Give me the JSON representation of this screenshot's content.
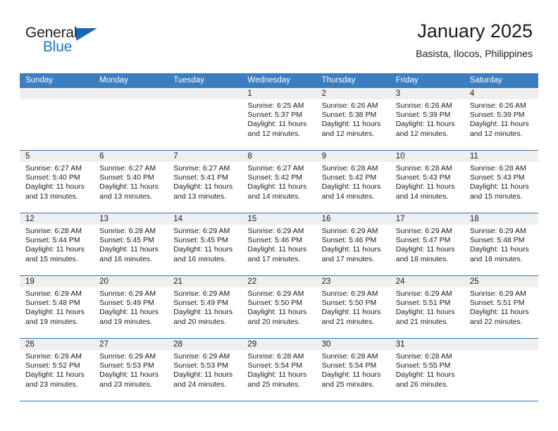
{
  "brand": {
    "name_part1": "General",
    "name_part2": "Blue"
  },
  "header": {
    "title": "January 2025",
    "subtitle": "Basista, Ilocos, Philippines"
  },
  "calendar": {
    "weekday_headers": [
      "Sunday",
      "Monday",
      "Tuesday",
      "Wednesday",
      "Thursday",
      "Friday",
      "Saturday"
    ],
    "accent_color": "#3a7ec0",
    "row_divider_color": "#2e75b6",
    "daynum_band_color": "#efefef",
    "weeks": [
      [
        {
          "day": "",
          "sunrise": "",
          "sunset": "",
          "daylight": "",
          "empty": true
        },
        {
          "day": "",
          "sunrise": "",
          "sunset": "",
          "daylight": "",
          "empty": true
        },
        {
          "day": "",
          "sunrise": "",
          "sunset": "",
          "daylight": "",
          "empty": true
        },
        {
          "day": "1",
          "sunrise": "Sunrise: 6:25 AM",
          "sunset": "Sunset: 5:37 PM",
          "daylight": "Daylight: 11 hours and 12 minutes."
        },
        {
          "day": "2",
          "sunrise": "Sunrise: 6:26 AM",
          "sunset": "Sunset: 5:38 PM",
          "daylight": "Daylight: 11 hours and 12 minutes."
        },
        {
          "day": "3",
          "sunrise": "Sunrise: 6:26 AM",
          "sunset": "Sunset: 5:39 PM",
          "daylight": "Daylight: 11 hours and 12 minutes."
        },
        {
          "day": "4",
          "sunrise": "Sunrise: 6:26 AM",
          "sunset": "Sunset: 5:39 PM",
          "daylight": "Daylight: 11 hours and 12 minutes."
        }
      ],
      [
        {
          "day": "5",
          "sunrise": "Sunrise: 6:27 AM",
          "sunset": "Sunset: 5:40 PM",
          "daylight": "Daylight: 11 hours and 13 minutes."
        },
        {
          "day": "6",
          "sunrise": "Sunrise: 6:27 AM",
          "sunset": "Sunset: 5:40 PM",
          "daylight": "Daylight: 11 hours and 13 minutes."
        },
        {
          "day": "7",
          "sunrise": "Sunrise: 6:27 AM",
          "sunset": "Sunset: 5:41 PM",
          "daylight": "Daylight: 11 hours and 13 minutes."
        },
        {
          "day": "8",
          "sunrise": "Sunrise: 6:27 AM",
          "sunset": "Sunset: 5:42 PM",
          "daylight": "Daylight: 11 hours and 14 minutes."
        },
        {
          "day": "9",
          "sunrise": "Sunrise: 6:28 AM",
          "sunset": "Sunset: 5:42 PM",
          "daylight": "Daylight: 11 hours and 14 minutes."
        },
        {
          "day": "10",
          "sunrise": "Sunrise: 6:28 AM",
          "sunset": "Sunset: 5:43 PM",
          "daylight": "Daylight: 11 hours and 14 minutes."
        },
        {
          "day": "11",
          "sunrise": "Sunrise: 6:28 AM",
          "sunset": "Sunset: 5:43 PM",
          "daylight": "Daylight: 11 hours and 15 minutes."
        }
      ],
      [
        {
          "day": "12",
          "sunrise": "Sunrise: 6:28 AM",
          "sunset": "Sunset: 5:44 PM",
          "daylight": "Daylight: 11 hours and 15 minutes."
        },
        {
          "day": "13",
          "sunrise": "Sunrise: 6:28 AM",
          "sunset": "Sunset: 5:45 PM",
          "daylight": "Daylight: 11 hours and 16 minutes."
        },
        {
          "day": "14",
          "sunrise": "Sunrise: 6:29 AM",
          "sunset": "Sunset: 5:45 PM",
          "daylight": "Daylight: 11 hours and 16 minutes."
        },
        {
          "day": "15",
          "sunrise": "Sunrise: 6:29 AM",
          "sunset": "Sunset: 5:46 PM",
          "daylight": "Daylight: 11 hours and 17 minutes."
        },
        {
          "day": "16",
          "sunrise": "Sunrise: 6:29 AM",
          "sunset": "Sunset: 5:46 PM",
          "daylight": "Daylight: 11 hours and 17 minutes."
        },
        {
          "day": "17",
          "sunrise": "Sunrise: 6:29 AM",
          "sunset": "Sunset: 5:47 PM",
          "daylight": "Daylight: 11 hours and 18 minutes."
        },
        {
          "day": "18",
          "sunrise": "Sunrise: 6:29 AM",
          "sunset": "Sunset: 5:48 PM",
          "daylight": "Daylight: 11 hours and 18 minutes."
        }
      ],
      [
        {
          "day": "19",
          "sunrise": "Sunrise: 6:29 AM",
          "sunset": "Sunset: 5:48 PM",
          "daylight": "Daylight: 11 hours and 19 minutes."
        },
        {
          "day": "20",
          "sunrise": "Sunrise: 6:29 AM",
          "sunset": "Sunset: 5:49 PM",
          "daylight": "Daylight: 11 hours and 19 minutes."
        },
        {
          "day": "21",
          "sunrise": "Sunrise: 6:29 AM",
          "sunset": "Sunset: 5:49 PM",
          "daylight": "Daylight: 11 hours and 20 minutes."
        },
        {
          "day": "22",
          "sunrise": "Sunrise: 6:29 AM",
          "sunset": "Sunset: 5:50 PM",
          "daylight": "Daylight: 11 hours and 20 minutes."
        },
        {
          "day": "23",
          "sunrise": "Sunrise: 6:29 AM",
          "sunset": "Sunset: 5:50 PM",
          "daylight": "Daylight: 11 hours and 21 minutes."
        },
        {
          "day": "24",
          "sunrise": "Sunrise: 6:29 AM",
          "sunset": "Sunset: 5:51 PM",
          "daylight": "Daylight: 11 hours and 21 minutes."
        },
        {
          "day": "25",
          "sunrise": "Sunrise: 6:29 AM",
          "sunset": "Sunset: 5:51 PM",
          "daylight": "Daylight: 11 hours and 22 minutes."
        }
      ],
      [
        {
          "day": "26",
          "sunrise": "Sunrise: 6:29 AM",
          "sunset": "Sunset: 5:52 PM",
          "daylight": "Daylight: 11 hours and 23 minutes."
        },
        {
          "day": "27",
          "sunrise": "Sunrise: 6:29 AM",
          "sunset": "Sunset: 5:53 PM",
          "daylight": "Daylight: 11 hours and 23 minutes."
        },
        {
          "day": "28",
          "sunrise": "Sunrise: 6:29 AM",
          "sunset": "Sunset: 5:53 PM",
          "daylight": "Daylight: 11 hours and 24 minutes."
        },
        {
          "day": "29",
          "sunrise": "Sunrise: 6:28 AM",
          "sunset": "Sunset: 5:54 PM",
          "daylight": "Daylight: 11 hours and 25 minutes."
        },
        {
          "day": "30",
          "sunrise": "Sunrise: 6:28 AM",
          "sunset": "Sunset: 5:54 PM",
          "daylight": "Daylight: 11 hours and 25 minutes."
        },
        {
          "day": "31",
          "sunrise": "Sunrise: 6:28 AM",
          "sunset": "Sunset: 5:55 PM",
          "daylight": "Daylight: 11 hours and 26 minutes."
        },
        {
          "day": "",
          "sunrise": "",
          "sunset": "",
          "daylight": "",
          "empty": true
        }
      ]
    ]
  }
}
